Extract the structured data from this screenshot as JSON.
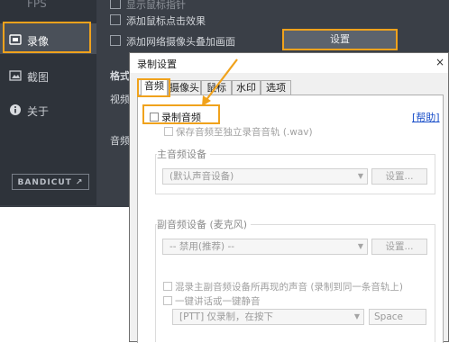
{
  "app": {
    "sidebar": {
      "fps_label": "FPS",
      "record_label": "录像",
      "screenshot_label": "截图",
      "about_label": "关于",
      "bandicut_label": "BANDICUT ↗"
    },
    "main": {
      "row1_label": "显示鼠标指针",
      "row2_label": "添加鼠标点击效果",
      "row3_label": "添加网络摄像头叠加画面",
      "settings_button": "设置",
      "format_label": "格式",
      "video_label": "视频",
      "audio_label": "音频"
    }
  },
  "dialog": {
    "title": "录制设置",
    "close_glyph": "×",
    "tabs": [
      "音频",
      "摄像头",
      "鼠标",
      "水印",
      "选项"
    ],
    "record_audio_label": "录制音频",
    "help_link": "[帮助]",
    "separate_track_label": "保存音频至独立录音音轨 (.wav)",
    "main_device": {
      "group_title": "主音频设备",
      "selected": "(默认声音设备)",
      "setup_button": "设置..."
    },
    "mic_device": {
      "group_title": "副音频设备 (麦克风)",
      "selected": "-- 禁用(推荐) --",
      "setup_button": "设置...",
      "mix_label": "混录主副音频设备所再现的声音 (录制到同一条音轨上)",
      "ptt_label": "一键讲话或一键静音",
      "hotkey_selected": "[PTT] 仅录制，在按下",
      "hotkey_value": "Space"
    }
  },
  "colors": {
    "highlight": "#f0a21c",
    "app_background": "#3a3f47",
    "help_link": "#1a4fc9"
  }
}
